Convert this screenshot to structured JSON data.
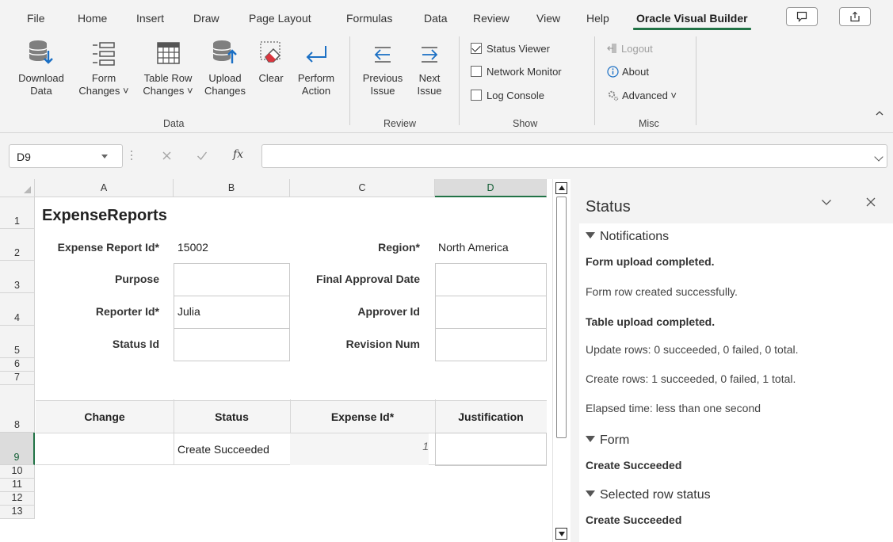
{
  "tabs": [
    "File",
    "Home",
    "Insert",
    "Draw",
    "Page Layout",
    "Formulas",
    "Data",
    "Review",
    "View",
    "Help",
    "Oracle Visual Builder"
  ],
  "ribbon": {
    "data_group": {
      "label": "Data",
      "buttons": [
        {
          "line1": "Download",
          "line2": "Data"
        },
        {
          "line1": "Form",
          "line2": "Changes ˅"
        },
        {
          "line1": "Table Row",
          "line2": "Changes ˅"
        },
        {
          "line1": "Upload",
          "line2": "Changes"
        },
        {
          "line1": "Clear",
          "line2": ""
        },
        {
          "line1": "Perform",
          "line2": "Action"
        }
      ]
    },
    "review_group": {
      "label": "Review",
      "buttons": [
        {
          "line1": "Previous",
          "line2": "Issue"
        },
        {
          "line1": "Next",
          "line2": "Issue"
        }
      ]
    },
    "show_group": {
      "label": "Show",
      "checks": [
        {
          "label": "Status Viewer",
          "checked": true
        },
        {
          "label": "Network Monitor",
          "checked": false
        },
        {
          "label": "Log Console",
          "checked": false
        }
      ]
    },
    "misc_group": {
      "label": "Misc",
      "logout": "Logout",
      "about": "About",
      "advanced": "Advanced ˅"
    }
  },
  "formula_bar": {
    "name_box": "D9",
    "fx": "fx",
    "value": ""
  },
  "grid": {
    "columns": [
      "A",
      "B",
      "C",
      "D"
    ],
    "rows": [
      "1",
      "2",
      "3",
      "4",
      "5",
      "6",
      "7",
      "8",
      "9",
      "10",
      "11",
      "12",
      "13"
    ],
    "selected_column": "D",
    "selected_row": "9",
    "form": {
      "title": "ExpenseReports",
      "expense_report_id_label": "Expense Report Id*",
      "expense_report_id_value": "15002",
      "region_label": "Region*",
      "region_value": "North America",
      "purpose_label": "Purpose",
      "final_approval_date_label": "Final Approval Date",
      "reporter_id_label": "Reporter Id*",
      "reporter_id_value": "Julia",
      "approver_id_label": "Approver Id",
      "status_id_label": "Status Id",
      "revision_num_label": "Revision Num"
    },
    "table": {
      "headers": [
        "Change",
        "Status",
        "Expense Id*",
        "Justification"
      ],
      "rows": [
        {
          "change": "",
          "status": "Create Succeeded",
          "expense_id": "1",
          "justification": ""
        }
      ]
    }
  },
  "status_pane": {
    "title": "Status",
    "notifications_heading": "Notifications",
    "messages": [
      "Form upload completed.",
      "Form row created successfully.",
      "Table upload completed.",
      "Update rows:  0 succeeded, 0 failed, 0 total.",
      "Create rows: 1 succeeded, 0 failed, 1 total.",
      "Elapsed time: less than one second"
    ],
    "form_heading": "Form",
    "form_status": "Create Succeeded",
    "selected_row_heading": "Selected row status",
    "selected_row_status": "Create Succeeded"
  },
  "colors": {
    "accent": "#217346",
    "ribbon_bg": "#f3f3f3"
  }
}
